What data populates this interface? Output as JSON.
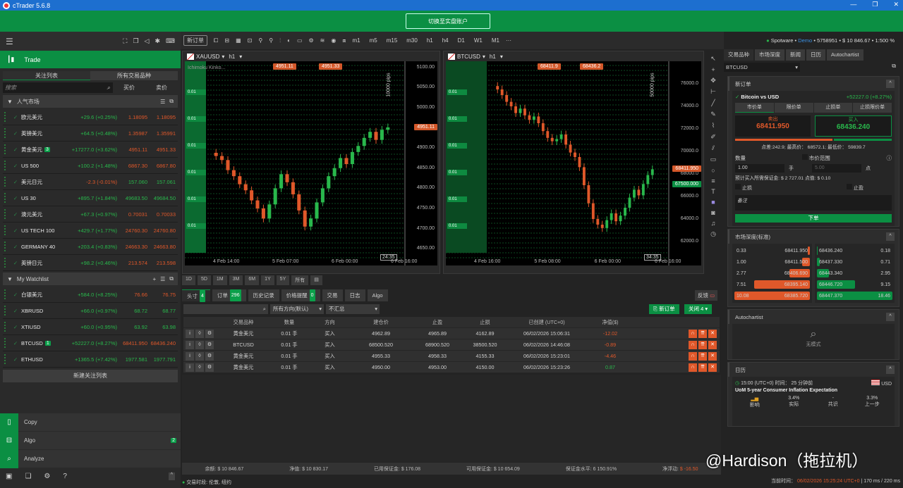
{
  "window": {
    "title": "cTrader 5.6.8",
    "controls": [
      "—",
      "❐",
      "✕"
    ]
  },
  "banner": {
    "switch_live": "切换至实盘账户"
  },
  "left": {
    "trade_label": "Trade",
    "tabs": [
      "关注列表",
      "所有交易品种"
    ],
    "search_placeholder": "搜索",
    "col_bid": "买价",
    "col_ask": "卖价",
    "popular_title": "人气市场",
    "popular": [
      {
        "name": "欧元美元",
        "change": "+29.6 (+0.25%)",
        "bid": "1.18095",
        "ask": "1.18095",
        "neg": false,
        "green": false
      },
      {
        "name": "英镑美元",
        "change": "+64.5 (+0.48%)",
        "bid": "1.35987",
        "ask": "1.35991",
        "neg": false,
        "green": false
      },
      {
        "name": "黄金美元",
        "badge": "3",
        "change": "+17277.0 (+3.62%)",
        "bid": "4951.11",
        "ask": "4951.33",
        "neg": false,
        "green": false
      },
      {
        "name": "US 500",
        "change": "+100.2 (+1.48%)",
        "bid": "6867.30",
        "ask": "6867.80",
        "neg": false,
        "green": false
      },
      {
        "name": "美元日元",
        "change": "-2.3 (-0.01%)",
        "bid": "157.060",
        "ask": "157.061",
        "neg": true,
        "green": true
      },
      {
        "name": "US 30",
        "change": "+895.7 (+1.84%)",
        "bid": "49683.50",
        "ask": "49684.50",
        "neg": false,
        "green": true
      },
      {
        "name": "澳元美元",
        "change": "+67.3 (+0.97%)",
        "bid": "0.70031",
        "ask": "0.70033",
        "neg": false,
        "green": false
      },
      {
        "name": "US TECH 100",
        "change": "+429.7 (+1.77%)",
        "bid": "24760.30",
        "ask": "24760.80",
        "neg": false,
        "green": false
      },
      {
        "name": "GERMANY 40",
        "change": "+203.4 (+0.83%)",
        "bid": "24663.30",
        "ask": "24663.80",
        "neg": false,
        "green": false
      },
      {
        "name": "英镑日元",
        "change": "+98.2 (+0.46%)",
        "bid": "213.574",
        "ask": "213.598",
        "neg": false,
        "green": false
      }
    ],
    "watchlist_title": "My Watchlist",
    "watchlist": [
      {
        "name": "白银美元",
        "change": "+584.0 (+8.25%)",
        "bid": "76.66",
        "ask": "76.75",
        "green": false
      },
      {
        "name": "XBRUSD",
        "change": "+66.0 (+0.97%)",
        "bid": "68.72",
        "ask": "68.77",
        "green": true
      },
      {
        "name": "XTIUSD",
        "change": "+60.0 (+0.95%)",
        "bid": "63.92",
        "ask": "63.98",
        "green": true
      },
      {
        "name": "BTCUSD",
        "badge": "1",
        "change": "+52227.0 (+8.27%)",
        "bid": "68411.950",
        "ask": "68436.240",
        "green": false
      },
      {
        "name": "ETHUSD",
        "change": "+1365.5 (+7.42%)",
        "bid": "1977.581",
        "ask": "1977.791",
        "green": true
      }
    ],
    "new_watchlist": "新建关注列表",
    "nav": [
      {
        "label": "Copy",
        "icon": "▯"
      },
      {
        "label": "Algo",
        "icon": "⊟",
        "badge": "2"
      },
      {
        "label": "Analyze",
        "icon": "⌕"
      }
    ]
  },
  "toolbar": {
    "new_order": "新订单",
    "timeframes": [
      "m1",
      "m5",
      "m15",
      "m30",
      "h1",
      "h4",
      "D1",
      "W1",
      "M1"
    ],
    "more": "···"
  },
  "charts": [
    {
      "symbol": "XAUUSD",
      "timeframe": "h1",
      "indicator": "Ichimoku Kinko...",
      "sell": "4951.11",
      "buy": "4951.33",
      "price_tag": "4951.11",
      "pips": "10000 pips",
      "countdown": "24:35",
      "y_ticks": [
        "5100.00",
        "5050.00",
        "5000.00",
        "4950.00",
        "4900.00",
        "4850.00",
        "4800.00",
        "4750.00",
        "4700.00",
        "4650.00"
      ],
      "ylim": [
        4640,
        5115
      ],
      "x_ticks": [
        "4 Feb 14:00",
        "5 Feb 07:00",
        "6 Feb 00:00",
        "6 Feb 16:00"
      ],
      "closes": [
        4880,
        4870,
        4845,
        4830,
        4810,
        4795,
        4770,
        4750,
        4725,
        4760,
        4800,
        4835,
        4815,
        4785,
        4745,
        4705,
        4725,
        4765,
        4800,
        4830,
        4850,
        4875,
        4860,
        4890,
        4905,
        4925,
        4940,
        4920,
        4945,
        4951
      ]
    },
    {
      "symbol": "BTCUSD",
      "timeframe": "h1",
      "sell": "68411.9",
      "buy": "68436.2",
      "price_tag": "68411.950",
      "target_tag": "67500.000",
      "pips": "50000 pips",
      "countdown": "34:35",
      "y_ticks": [
        "76000.0",
        "74000.0",
        "72000.0",
        "70000.0",
        "68000.0",
        "66000.0",
        "64000.0",
        "62000.0"
      ],
      "ylim": [
        61000,
        78000
      ],
      "x_ticks": [
        "4 Feb 16:00",
        "5 Feb 08:00",
        "6 Feb 00:00",
        "6 Feb 16:00"
      ],
      "closes": [
        75500,
        75000,
        74400,
        74000,
        73400,
        73800,
        73200,
        72800,
        73100,
        72500,
        71800,
        71200,
        70900,
        71100,
        71500,
        70600,
        69900,
        69500,
        68600,
        67000,
        65400,
        64000,
        63500,
        63200,
        63900,
        64500,
        63800,
        64300,
        65000,
        65900,
        66600,
        66100,
        67100,
        67900,
        68412
      ]
    }
  ],
  "position_marker": "0.01",
  "range_buttons": [
    "1D",
    "5D",
    "1M",
    "3M",
    "6M",
    "1Y",
    "5Y",
    "所有"
  ],
  "bottom": {
    "tabs": [
      {
        "label": "头寸",
        "badge": "4"
      },
      {
        "label": "订单",
        "badge": "296"
      },
      {
        "label": "历史记录"
      },
      {
        "label": "价格提醒",
        "badge": "0"
      },
      {
        "label": "交易"
      },
      {
        "label": "日志"
      },
      {
        "label": "Algo"
      }
    ],
    "feedback": "反馈",
    "filter_direction": "所有方向(默认)",
    "filter_group": "不汇总",
    "new_order": "新订单",
    "close_all": "关闭 4",
    "columns": [
      "",
      "交易品种",
      "数量",
      "方向",
      "建仓价",
      "止盈",
      "止损",
      "已创建 (UTC+0)",
      "净值($)",
      ""
    ],
    "rows": [
      {
        "symbol": "黄金美元",
        "qty": "0.01 手",
        "dir": "买入",
        "entry": "4962.89",
        "tp": "4965.89",
        "sl": "4162.89",
        "created": "06/02/2026 15:06:31",
        "net": "-12.02",
        "neg": true
      },
      {
        "symbol": "BTCUSD",
        "qty": "0.01 手",
        "dir": "买入",
        "entry": "68500.520",
        "tp": "68900.520",
        "sl": "38500.520",
        "created": "06/02/2026 14:46:08",
        "net": "-0.89",
        "neg": true
      },
      {
        "symbol": "黄金美元",
        "qty": "0.01 手",
        "dir": "买入",
        "entry": "4955.33",
        "tp": "4958.33",
        "sl": "4155.33",
        "created": "06/02/2026 15:23:01",
        "net": "-4.46",
        "neg": true
      },
      {
        "symbol": "黄金美元",
        "qty": "0.01 手",
        "dir": "买入",
        "entry": "4950.00",
        "tp": "4953.00",
        "sl": "4150.00",
        "created": "06/02/2026 15:23:26",
        "net": "0.87",
        "neg": false
      }
    ],
    "summary": {
      "balance": "余额: $ 10 846.67",
      "equity": "净值: $ 10 830.17",
      "used_margin": "已用保证金: $ 176.08",
      "free_margin": "可用保证金: $ 10 654.09",
      "margin_level": "保证金水平: 6 150.91%",
      "pnl_label": "净浮动:",
      "pnl": "$ -16.50"
    },
    "session": "交易时段: 伦敦, 纽约"
  },
  "right": {
    "account": {
      "broker": "Spotware",
      "type": "Demo",
      "id": "5758951",
      "balance": "$ 10 846.67",
      "leverage": "1:500"
    },
    "tabs": [
      "交易品种",
      "市场深度",
      "新闻",
      "日历",
      "Autochartist"
    ],
    "symbol": "BTCUSD",
    "new_order_title": "新订单",
    "instrument": "Bitcoin vs USD",
    "instrument_change": "+52227.0 (+8.27%)",
    "order_types": [
      "市价单",
      "限价单",
      "止损单",
      "止损限价单"
    ],
    "sell_label": "卖出",
    "sell_price": "68411.950",
    "buy_label": "买入",
    "buy_price": "68436.240",
    "sell_ratio": 0.62,
    "spread_line": "点差:242.9; 最高价： 68572.1; 最低价： 59839.7",
    "qty_label": "数量",
    "range_label": "市价范围",
    "qty": "1.00",
    "qty_unit": "手",
    "range_value": "5.00",
    "range_unit": "点",
    "margin_line": "预计买入所需保证金: $ 2 727.01 点值: $ 0.10",
    "sl_label": "止损",
    "tp_label": "止盈",
    "note_placeholder": "备注",
    "place_order": "下单",
    "depth_title": "市场深度(标准)",
    "depth_bids": [
      {
        "vol": "0.33",
        "price": "68411.950",
        "w": 0.03
      },
      {
        "vol": "1.00",
        "price": "68411.500",
        "w": 0.1
      },
      {
        "vol": "2.77",
        "price": "68406.690",
        "w": 0.27
      },
      {
        "vol": "7.51",
        "price": "68395.140",
        "w": 0.74
      },
      {
        "vol": "10.08",
        "price": "68385.720",
        "w": 1.0
      }
    ],
    "depth_asks": [
      {
        "vol": "0.18",
        "price": "68436.240",
        "w": 0.01
      },
      {
        "vol": "0.71",
        "price": "68437.330",
        "w": 0.04
      },
      {
        "vol": "2.95",
        "price": "68443.340",
        "w": 0.16
      },
      {
        "vol": "9.15",
        "price": "68446.720",
        "w": 0.5
      },
      {
        "vol": "18.46",
        "price": "68447.370",
        "w": 1.0
      }
    ],
    "autochartist_title": "Autochartist",
    "no_pattern": "无模式",
    "calendar_title": "日历",
    "event": {
      "time": "15:00 (UTC+0) 时间： 25 分钟前",
      "currency": "USD",
      "title": "UoM 5-year Consumer Inflation Expectation",
      "impact": "影响",
      "actual": "3.4%",
      "actual_label": "实际",
      "consensus": "-",
      "consensus_label": "共识",
      "previous": "3.3%",
      "previous_label": "上一步"
    }
  },
  "status": {
    "label": "当前时间：",
    "time": "06/02/2026 15:25:24",
    "tz": "UTC+0",
    "latency": "| 170 ms / 220 ms"
  },
  "watermark": "@Hardison（拖拉机）",
  "colors": {
    "green": "#0b8f43",
    "orange": "#e0582a",
    "up": "#29b84c"
  }
}
